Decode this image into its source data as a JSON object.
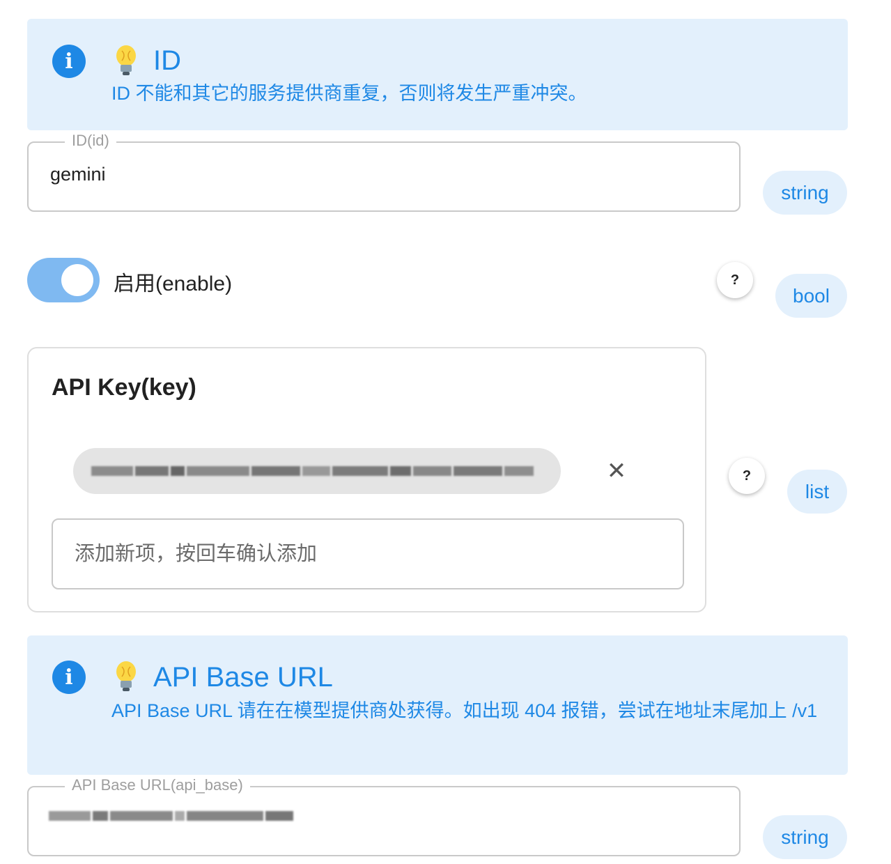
{
  "id_section": {
    "info_title": "ID",
    "info_text": "ID 不能和其它的服务提供商重复，否则将发生严重冲突。",
    "field_label": "ID(id)",
    "field_value": "gemini",
    "type": "string"
  },
  "enable_section": {
    "label": "启用(enable)",
    "enabled": true,
    "help": "?",
    "type": "bool"
  },
  "key_section": {
    "title": "API Key(key)",
    "remove_icon": "close-icon",
    "remove_glyph": "✕",
    "add_placeholder": "添加新项，按回车确认添加",
    "help": "?",
    "type": "list"
  },
  "api_base_section": {
    "info_title": "API Base URL",
    "info_text": "API Base URL 请在在模型提供商处获得。如出现 404 报错，尝试在地址末尾加上 /v1",
    "field_label": "API Base URL(api_base)",
    "type": "string"
  },
  "colors": {
    "accent": "#1e88e5",
    "info_bg": "#e3f0fc",
    "toggle_on": "#7fb9f1"
  }
}
